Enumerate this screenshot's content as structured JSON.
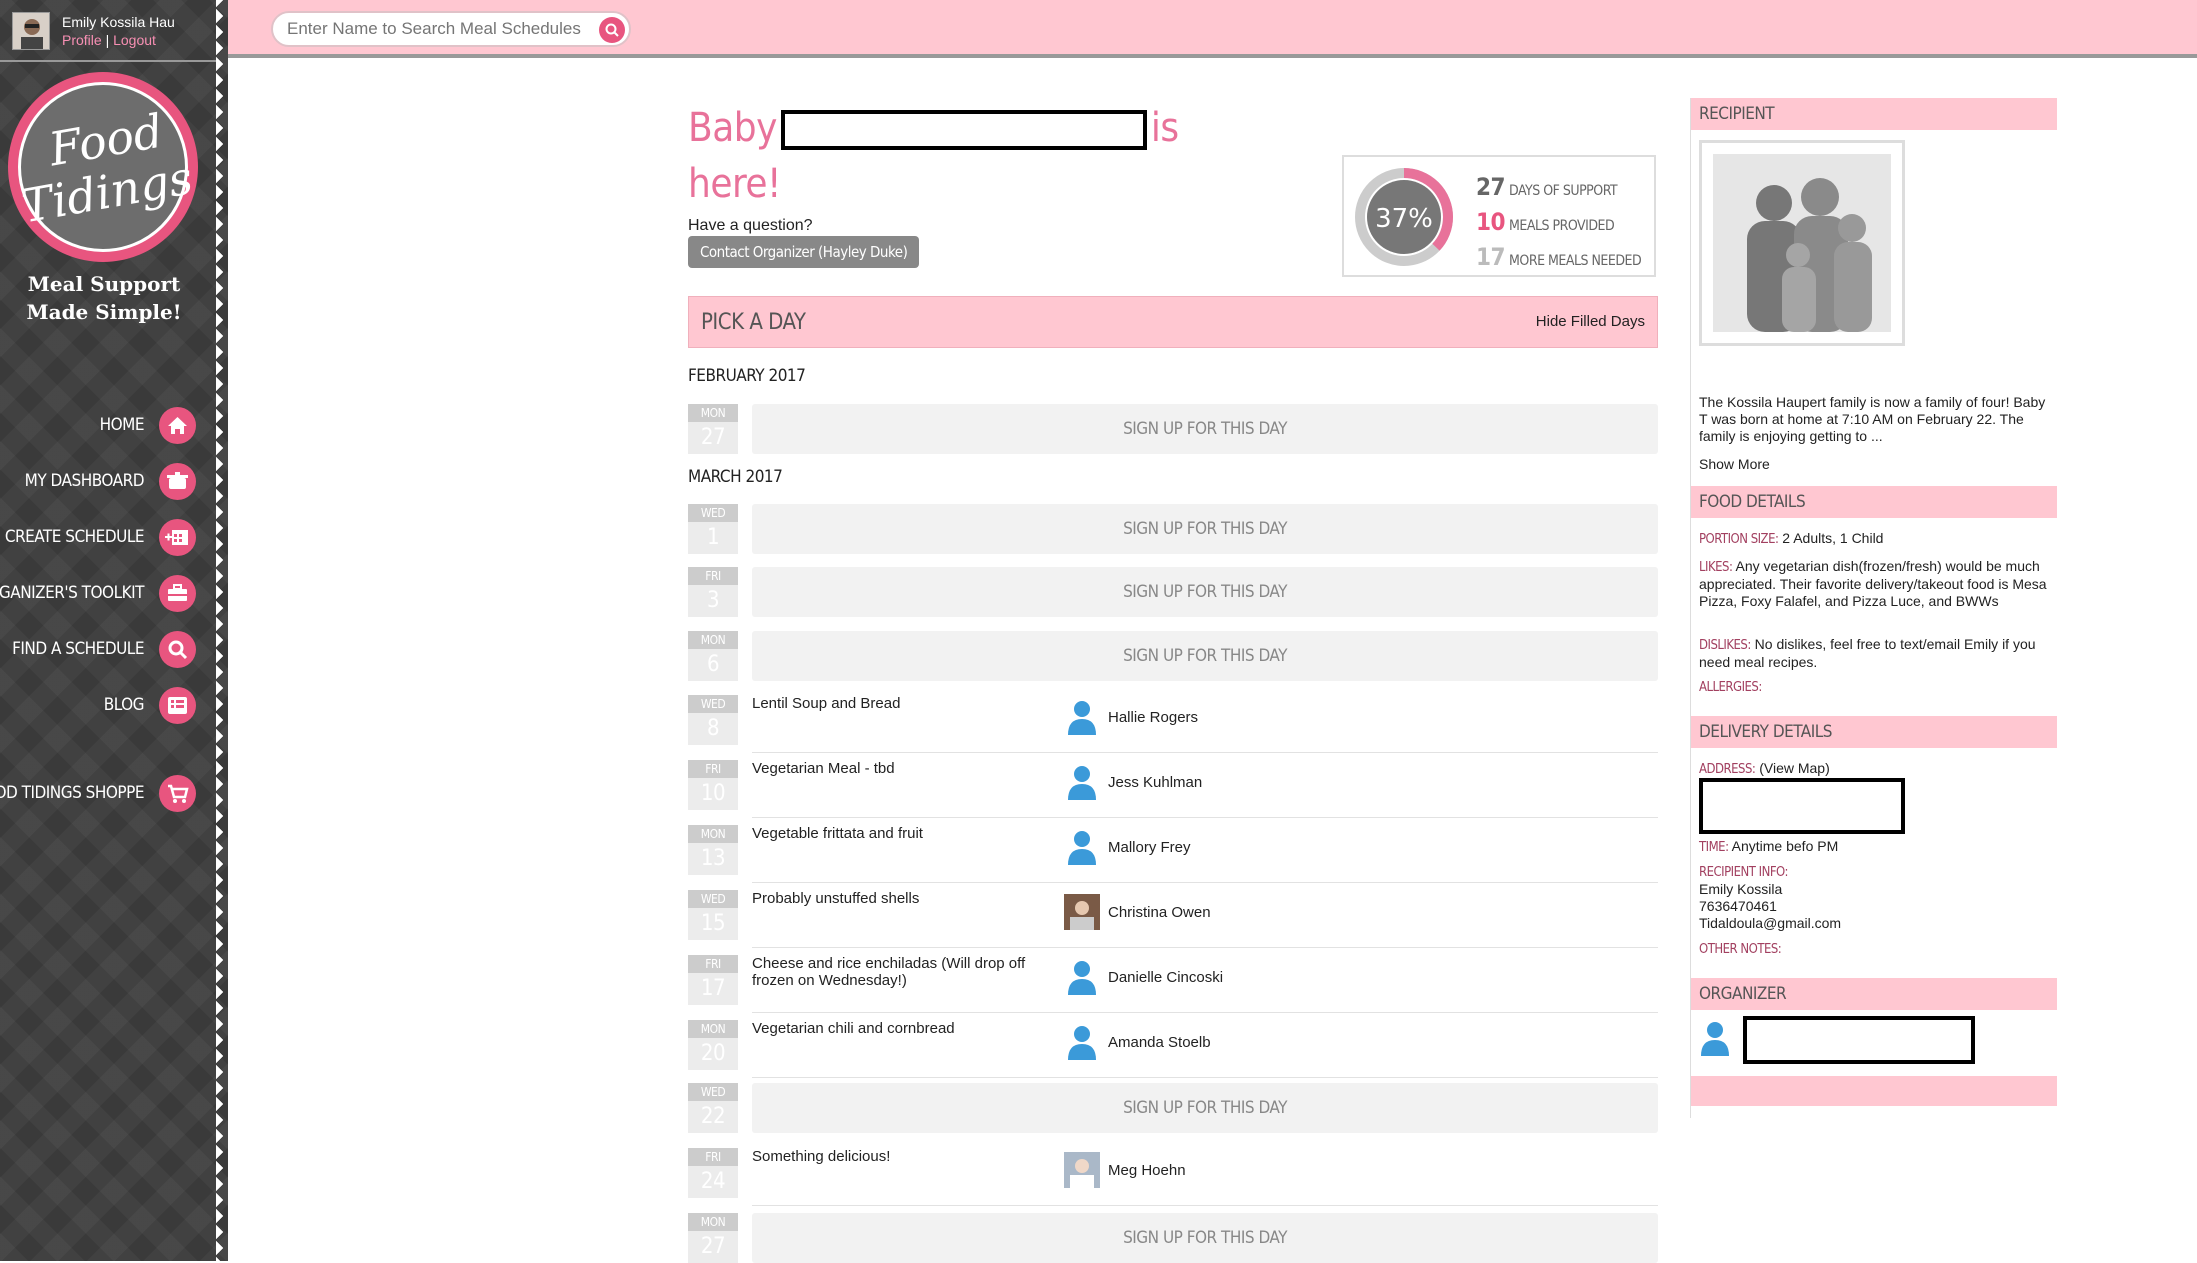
{
  "user": {
    "name": "Emily Kossila Hau",
    "profile": "Profile",
    "sep": "|",
    "logout": "Logout"
  },
  "logo": {
    "line1": "Food",
    "line2": "Tidings",
    "tag1": "Meal Support",
    "tag2": "Made Simple!"
  },
  "nav": [
    {
      "label": "HOME",
      "icon": "home-icon"
    },
    {
      "label": "MY DASHBOARD",
      "icon": "pot-icon"
    },
    {
      "label": "CREATE SCHEDULE",
      "icon": "calendar-add-icon"
    },
    {
      "label": "ORGANIZER'S TOOLKIT",
      "icon": "toolbox-icon"
    },
    {
      "label": "FIND A SCHEDULE",
      "icon": "search-icon"
    },
    {
      "label": "BLOG",
      "icon": "list-icon"
    },
    {
      "label": "FOOD TIDINGS SHOPPE",
      "icon": "cart-icon"
    }
  ],
  "search": {
    "placeholder": "Enter Name to Search Meal Schedules"
  },
  "header": {
    "title_pre": "Baby",
    "title_post": "is",
    "title_line2": "here!",
    "question": "Have a question?",
    "contact": "Contact Organizer (Hayley Duke)"
  },
  "stats": {
    "percent": "37%",
    "percent_value": 0.37,
    "days": "27",
    "days_label": "DAYS OF SUPPORT",
    "provided": "10",
    "provided_label": "MEALS PROVIDED",
    "needed": "17",
    "needed_label": "MORE MEALS NEEDED"
  },
  "pickday": {
    "title": "PICK A DAY",
    "hide": "Hide Filled Days"
  },
  "months": [
    "FEBRUARY 2017",
    "MARCH 2017"
  ],
  "signup_label": "SIGN UP FOR THIS DAY",
  "days": [
    {
      "dow": "MON",
      "dn": "27",
      "meal": "",
      "person": ""
    },
    {
      "dow": "WED",
      "dn": "1",
      "meal": "",
      "person": ""
    },
    {
      "dow": "FRI",
      "dn": "3",
      "meal": "",
      "person": ""
    },
    {
      "dow": "MON",
      "dn": "6",
      "meal": "",
      "person": ""
    },
    {
      "dow": "WED",
      "dn": "8",
      "meal": "Lentil Soup and Bread",
      "person": "Hallie Rogers"
    },
    {
      "dow": "FRI",
      "dn": "10",
      "meal": "Vegetarian Meal - tbd",
      "person": "Jess Kuhlman"
    },
    {
      "dow": "MON",
      "dn": "13",
      "meal": "Vegetable frittata and fruit",
      "person": "Mallory Frey"
    },
    {
      "dow": "WED",
      "dn": "15",
      "meal": "Probably unstuffed shells",
      "person": "Christina Owen"
    },
    {
      "dow": "FRI",
      "dn": "17",
      "meal": "Cheese and rice enchiladas (Will drop off frozen on Wednesday!)",
      "person": "Danielle Cincoski"
    },
    {
      "dow": "MON",
      "dn": "20",
      "meal": "Vegetarian chili and cornbread",
      "person": "Amanda Stoelb"
    },
    {
      "dow": "WED",
      "dn": "22",
      "meal": "",
      "person": ""
    },
    {
      "dow": "FRI",
      "dn": "24",
      "meal": "Something delicious!",
      "person": "Meg Hoehn"
    },
    {
      "dow": "MON",
      "dn": "27",
      "meal": "",
      "person": ""
    }
  ],
  "recipient": {
    "title": "RECIPIENT",
    "desc": "The Kossila Haupert family is now a family of four! Baby T was born at home at 7:10 AM on February 22. The family is enjoying getting to ...",
    "show_more": "Show More"
  },
  "food": {
    "title": "FOOD DETAILS",
    "portion_label": "PORTION SIZE:",
    "portion": "2 Adults, 1 Child",
    "likes_label": "LIKES:",
    "likes": "Any vegetarian dish(frozen/fresh) would be much appreciated. Their favorite delivery/takeout food is Mesa Pizza, Foxy Falafel, and Pizza Luce, and BWWs",
    "dislikes_label": "DISLIKES:",
    "dislikes": "No dislikes, feel free to text/email Emily if you need meal recipes.",
    "allergies_label": "ALLERGIES:"
  },
  "delivery": {
    "title": "DELIVERY DETAILS",
    "address_label": "ADDRESS:",
    "view_map": "(View Map)",
    "time_label": "TIME:",
    "time": "Anytime befo PM",
    "info_label": "RECIPIENT INFO:",
    "info_name": "Emily Kossila",
    "info_phone": "7636470461",
    "info_email": "Tidaldoula@gmail.com",
    "notes_label": "OTHER NOTES:"
  },
  "organizer": {
    "title": "ORGANIZER"
  },
  "colors": {
    "pink": "#e8557f",
    "light_pink": "#ffc7d1",
    "sidebar": "#3a3a3a"
  }
}
